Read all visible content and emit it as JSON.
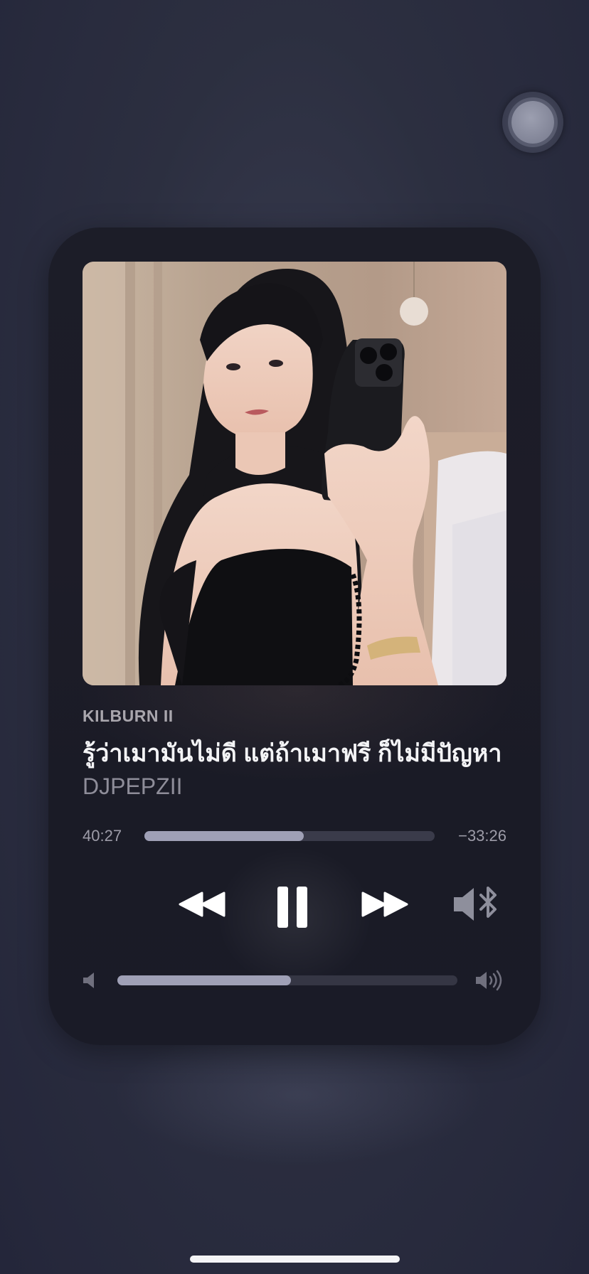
{
  "now_playing": {
    "artist": "KILBURN II",
    "title_line1": "รู้ว่าเมามันไม่ดี แต่ถ้าเมาฟรี ก็ไม่มีปัญหา by",
    "title_line2": "DJPEPZII",
    "artwork_icon": "album-artwork"
  },
  "playback": {
    "elapsed": "40:27",
    "remaining": "−33:26",
    "progress_fraction": 0.55
  },
  "controls": {
    "rewind_icon": "rewind-icon",
    "pause_icon": "pause-icon",
    "forward_icon": "fast-forward-icon",
    "output_icon": "bluetooth-speaker-icon"
  },
  "volume": {
    "level_fraction": 0.51,
    "low_icon": "volume-low-icon",
    "high_icon": "volume-high-icon"
  },
  "colors": {
    "background": "#2c2f40",
    "card": "#1c1d28",
    "fill": "#9fa0b6",
    "track": "#3a3b4a"
  }
}
